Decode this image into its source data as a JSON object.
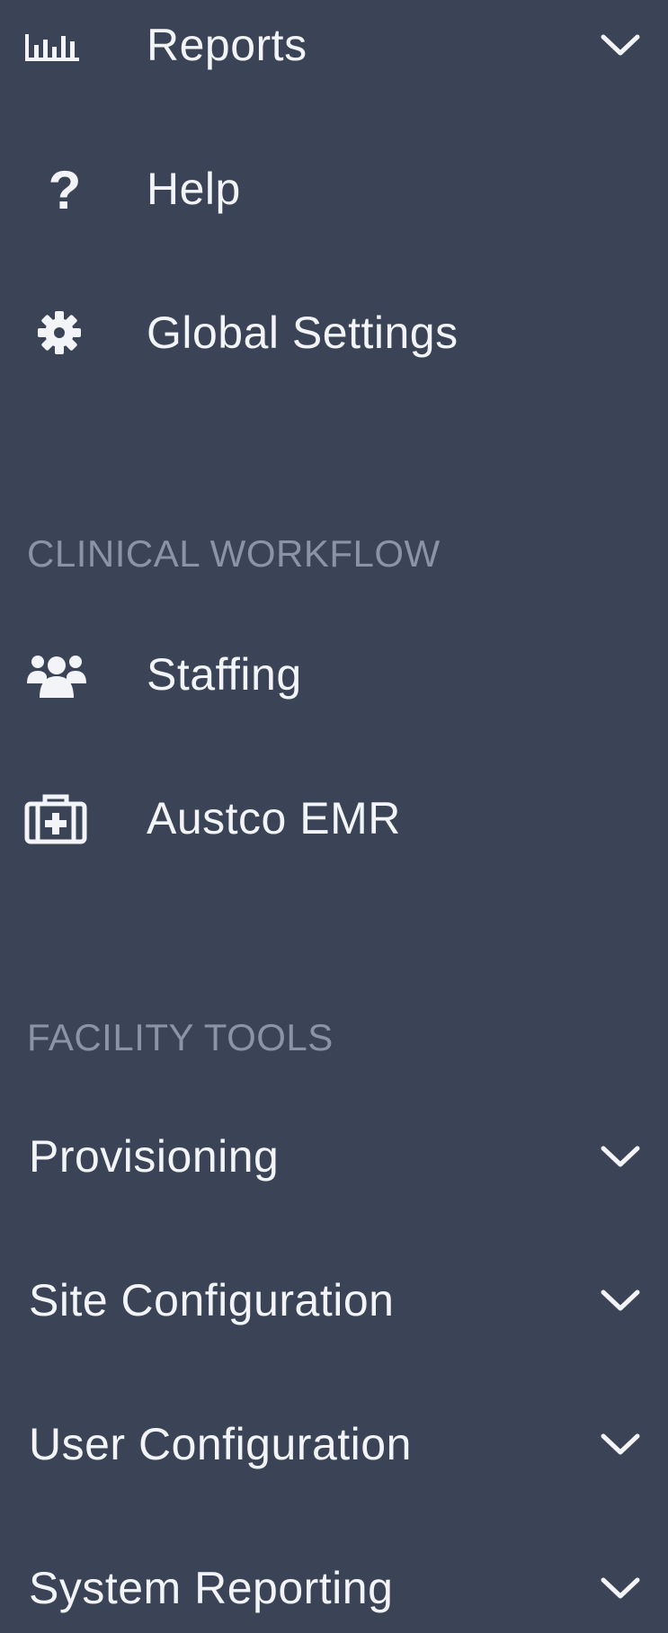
{
  "sidebar": {
    "items": [
      {
        "label": "Reports",
        "icon": "bar-chart-icon",
        "expandable": true
      },
      {
        "label": "Help",
        "icon": "question-icon",
        "expandable": false
      },
      {
        "label": "Global Settings",
        "icon": "gear-icon",
        "expandable": false
      }
    ],
    "sections": [
      {
        "header": "CLINICAL WORKFLOW",
        "items": [
          {
            "label": "Staffing",
            "icon": "users-icon"
          },
          {
            "label": "Austco EMR",
            "icon": "medical-kit-icon"
          }
        ]
      },
      {
        "header": "FACILITY TOOLS",
        "items": [
          {
            "label": "Provisioning",
            "expandable": true
          },
          {
            "label": "Site Configuration",
            "expandable": true
          },
          {
            "label": "User Configuration",
            "expandable": true
          },
          {
            "label": "System Reporting",
            "expandable": true
          }
        ]
      }
    ]
  },
  "colors": {
    "background": "#3a4456",
    "text": "#f2f4f7",
    "section_header": "#8a94a6"
  }
}
